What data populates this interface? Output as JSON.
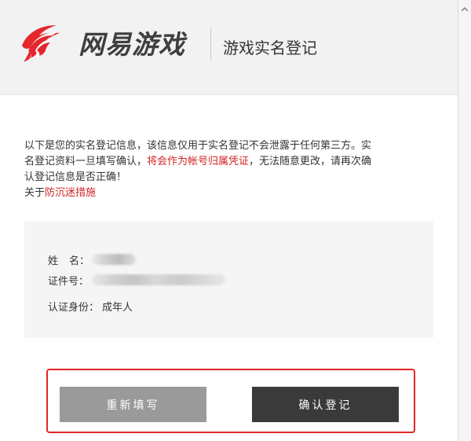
{
  "header": {
    "logo_text": "网易游戏",
    "page_title": "游戏实名登记"
  },
  "notice": {
    "line1": "以下是您的实名登记信息，该信息仅用于实名登记不会泄露于任何第三方。实",
    "line2_prefix": "名登记资料一旦填写确认，",
    "line2_red": "将会作为帐号归属凭证",
    "line2_suffix": "，无法随意更改，请再次确",
    "line3": "认登记信息是否正确！",
    "line4_prefix": "关于",
    "line4_link": "防沉迷措施"
  },
  "info": {
    "name_label_first": "姓",
    "name_label_second": "名：",
    "id_label": "证件号：",
    "role_label": "认证身份：",
    "role_value": "成年人"
  },
  "buttons": {
    "refill": "重新填写",
    "confirm": "确认登记"
  },
  "colors": {
    "accent": "#d22323",
    "highlight": "#e32626",
    "header_bg": "#f2f2f2",
    "panel_bg": "#f5f5f5",
    "refill_button": "#9a9a9a",
    "confirm_button": "#3a3a3a"
  },
  "icons": {
    "logo": "netease-logo-icon",
    "scroll": "chevron-up-icon"
  }
}
